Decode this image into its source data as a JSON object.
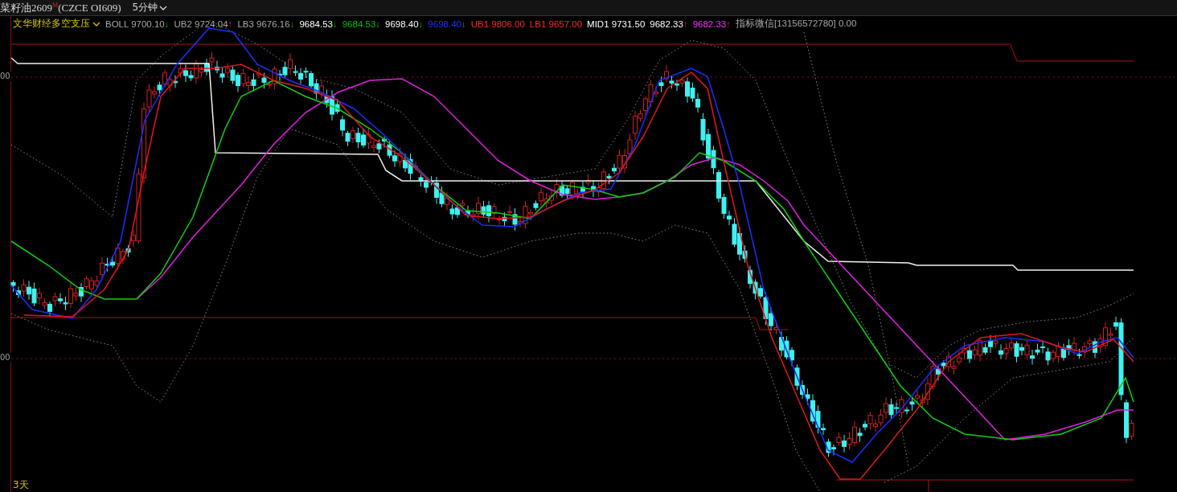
{
  "header": {
    "title": "菜籽油2609",
    "badge": "M",
    "code": "(CZCE OI609)",
    "period": "5分钟"
  },
  "indicator": {
    "name": "文华财经多空支压",
    "items": [
      {
        "text": "BOLL 9700.10",
        "color": "#a8a8a8",
        "arrow": "↓",
        "rising": false
      },
      {
        "text": "UB2 9724.04",
        "color": "#a8a8a8",
        "arrow": "↑",
        "rising": true
      },
      {
        "text": "LB3 9676.16",
        "color": "#a8a8a8",
        "arrow": "↓",
        "rising": false
      },
      {
        "text": "9684.53",
        "color": "#ffffff",
        "arrow": "↓",
        "rising": false
      },
      {
        "text": "9684.53",
        "color": "#00c000",
        "arrow": "↓",
        "rising": false
      },
      {
        "text": "9698.40",
        "color": "#ffffff",
        "arrow": "↓",
        "rising": false
      },
      {
        "text": "9698.40",
        "color": "#2030ff",
        "arrow": "↓",
        "rising": false
      },
      {
        "text": "UB1 9806.00",
        "color": "#ff2a2a"
      },
      {
        "text": "LB1 9657.00",
        "color": "#ff2a2a"
      },
      {
        "text": "MID1 9731.50",
        "color": "#ffffff"
      },
      {
        "text": "9682.33",
        "color": "#ffffff",
        "arrow": "↑",
        "rising": true
      },
      {
        "text": "9682.33",
        "color": "#ff30ff",
        "arrow": "↑",
        "rising": true
      },
      {
        "text": "指标微信[13156572780] 0.00",
        "color": "#a8a8a8"
      }
    ]
  },
  "axis_labels": [
    "00",
    "00"
  ],
  "range_label": "3天"
}
